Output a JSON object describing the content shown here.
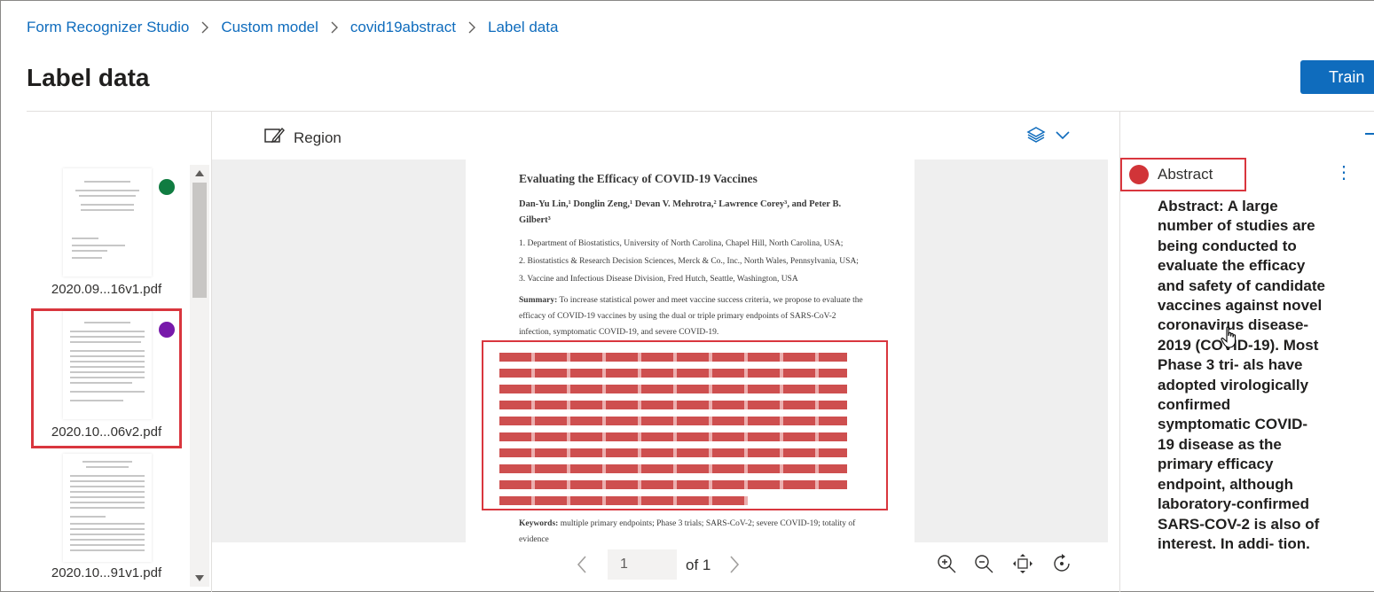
{
  "breadcrumb": [
    "Form Recognizer Studio",
    "Custom model",
    "covid19abstract",
    "Label data"
  ],
  "page_title": "Label data",
  "train_label": "Train",
  "toolbar": {
    "region_label": "Region"
  },
  "files": [
    {
      "name": "2020.09...16v1.pdf",
      "dot_color": "#107c41",
      "selected": false
    },
    {
      "name": "2020.10...06v2.pdf",
      "dot_color": "#7719aa",
      "selected": true
    },
    {
      "name": "2020.10...91v1.pdf",
      "dot_color": "",
      "selected": false
    }
  ],
  "document": {
    "title": "Evaluating the Efficacy of COVID-19 Vaccines",
    "authors": "Dan-Yu Lin,¹ Donglin Zeng,¹ Devan V. Mehrotra,² Lawrence Corey³, and Peter B. Gilbert³",
    "affiliations": [
      "1. Department of Biostatistics, University of North Carolina, Chapel Hill, North Carolina, USA;",
      "2. Biostatistics & Research Decision Sciences, Merck & Co., Inc., North Wales, Pennsylvania, USA;",
      "3. Vaccine and Infectious Disease Division, Fred Hutch, Seattle, Washington, USA"
    ],
    "summary_head": "Summary:",
    "summary_text": "To increase statistical power and meet vaccine success criteria, we propose to evaluate the efficacy of COVID-19 vaccines by using the dual or triple primary endpoints of SARS-CoV-2 infection, symptomatic COVID-19, and severe COVID-19.",
    "keywords_head": "Keywords:",
    "keywords_text": "multiple primary endpoints; Phase 3 trials; SARS-CoV-2; severe COVID-19; totality of evidence"
  },
  "pager": {
    "page_value": "1",
    "of_label": "of 1"
  },
  "field": {
    "name": "Abstract",
    "color": "#d13438",
    "value": "Abstract: A large number of studies are being conducted to evaluate the efficacy and safety of candidate vaccines against novel coronavirus disease- 2019 (COVID-19). Most Phase 3 tri- als have adopted virologically confirmed symptomatic COVID- 19 disease as the primary efficacy endpoint, although laboratory-confirmed SARS-COV-2 is also of interest. In addi- tion."
  },
  "icons": [
    "chevron-right-icon",
    "edit-region-icon",
    "layers-icon",
    "chevron-down-icon",
    "chevron-left-icon",
    "zoom-in-icon",
    "zoom-out-icon",
    "fit-to-screen-icon",
    "rotate-icon",
    "more-icon"
  ]
}
